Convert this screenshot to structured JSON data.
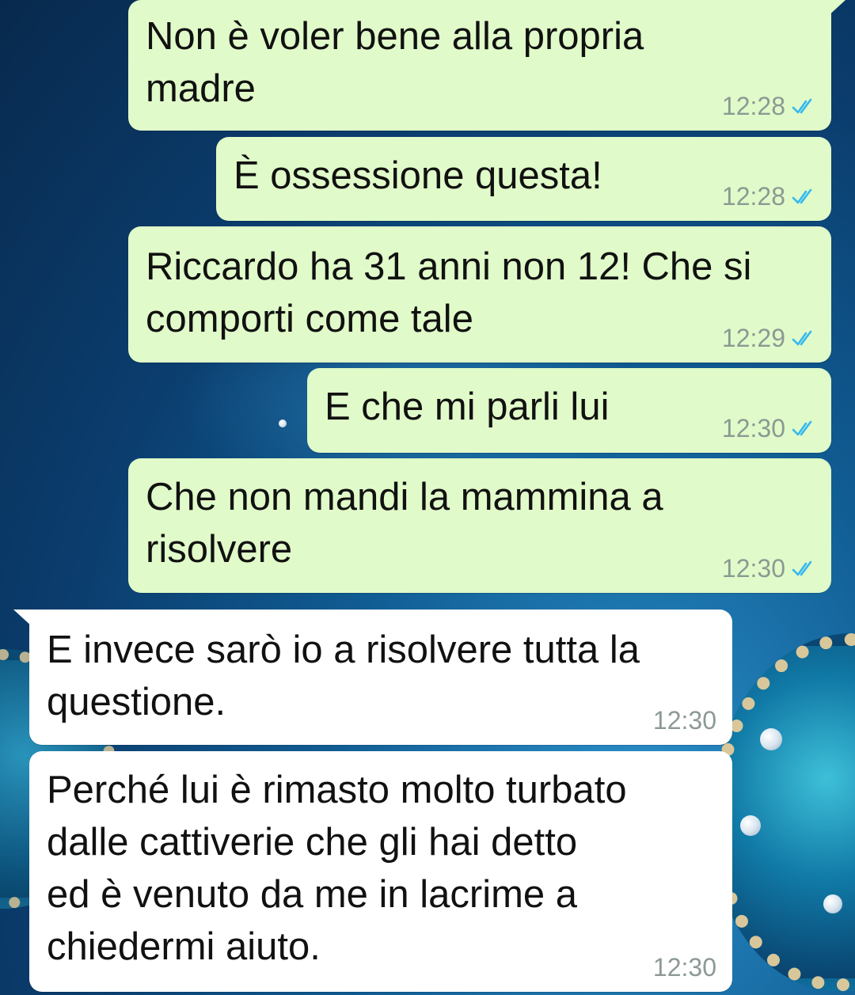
{
  "colors": {
    "outgoing_bubble": "#e0fbc9",
    "incoming_bubble": "#ffffff",
    "read_ticks": "#34b7f1",
    "timestamp": "#8c9994"
  },
  "messages": [
    {
      "direction": "outgoing",
      "text": "Non è voler bene alla propria\nmadre",
      "time": "12:28",
      "status_icon": "double-check-read-icon"
    },
    {
      "direction": "outgoing",
      "text": "È ossessione questa!",
      "time": "12:28",
      "status_icon": "double-check-read-icon"
    },
    {
      "direction": "outgoing",
      "text": "Riccardo ha 31 anni non 12! Che si\ncomporti come tale",
      "time": "12:29",
      "status_icon": "double-check-read-icon"
    },
    {
      "direction": "outgoing",
      "text": "E che mi parli lui",
      "time": "12:30",
      "status_icon": "double-check-read-icon"
    },
    {
      "direction": "outgoing",
      "text": "Che non mandi la mammina a\nrisolvere",
      "time": "12:30",
      "status_icon": "double-check-read-icon"
    },
    {
      "direction": "incoming",
      "text": "E invece sarò io a risolvere tutta la\nquestione.",
      "time": "12:30"
    },
    {
      "direction": "incoming",
      "text": "Perché lui è rimasto molto turbato\ndalle cattiverie che gli hai detto\ned è venuto da me in lacrime a\nchiedermi aiuto.",
      "time": "12:30"
    }
  ]
}
